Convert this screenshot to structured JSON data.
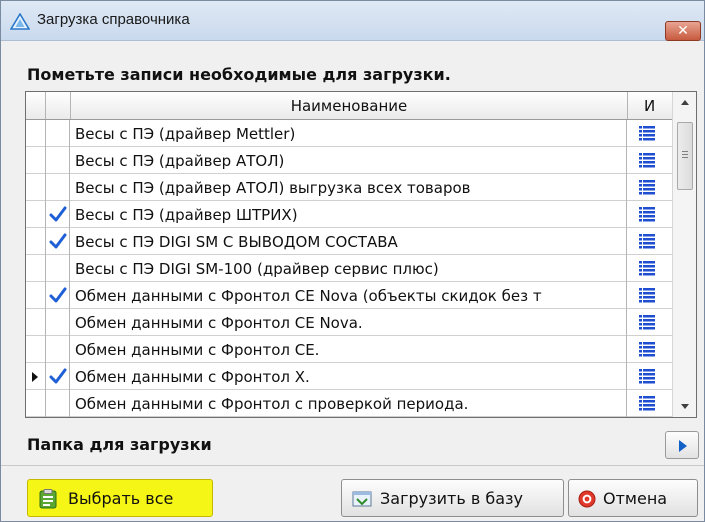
{
  "window": {
    "title": "Загрузка справочника",
    "close_symbol": "✕"
  },
  "prompt": "Пометьте записи необходимые для загрузки.",
  "grid": {
    "columns": {
      "name": "Наименование",
      "icon": "И"
    },
    "rows": [
      {
        "name": "Весы с ПЭ (драйвер Mettler)",
        "checked": false,
        "current": false
      },
      {
        "name": "Весы с ПЭ (драйвер АТОЛ)",
        "checked": false,
        "current": false
      },
      {
        "name": "Весы с ПЭ (драйвер АТОЛ) выгрузка всех товаров",
        "checked": false,
        "current": false
      },
      {
        "name": "Весы с ПЭ (драйвер ШТРИХ)",
        "checked": true,
        "current": false
      },
      {
        "name": "Весы с ПЭ DIGI SM С ВЫВОДОМ СОСТАВА",
        "checked": true,
        "current": false
      },
      {
        "name": "Весы с ПЭ DIGI SM-100 (драйвер сервис плюс)",
        "checked": false,
        "current": false
      },
      {
        "name": "Обмен данными с Фронтол CE Nova (объекты скидок без т",
        "checked": true,
        "current": false
      },
      {
        "name": "Обмен данными с Фронтол CE Nova.",
        "checked": false,
        "current": false
      },
      {
        "name": "Обмен данными с Фронтол CE.",
        "checked": false,
        "current": false
      },
      {
        "name": "Обмен данными с Фронтол X.",
        "checked": true,
        "current": true
      },
      {
        "name": "Обмен данными с Фронтол с проверкой периода.",
        "checked": false,
        "current": false
      }
    ]
  },
  "folder": {
    "label": "Папка для загрузки"
  },
  "buttons": {
    "select_all": "Выбрать все",
    "load": "Загрузить в базу",
    "cancel": "Отмена"
  },
  "colors": {
    "check": "#1f5fd6",
    "list_icon": "#1f4fd0",
    "select_all_bg": "#f5f516"
  }
}
